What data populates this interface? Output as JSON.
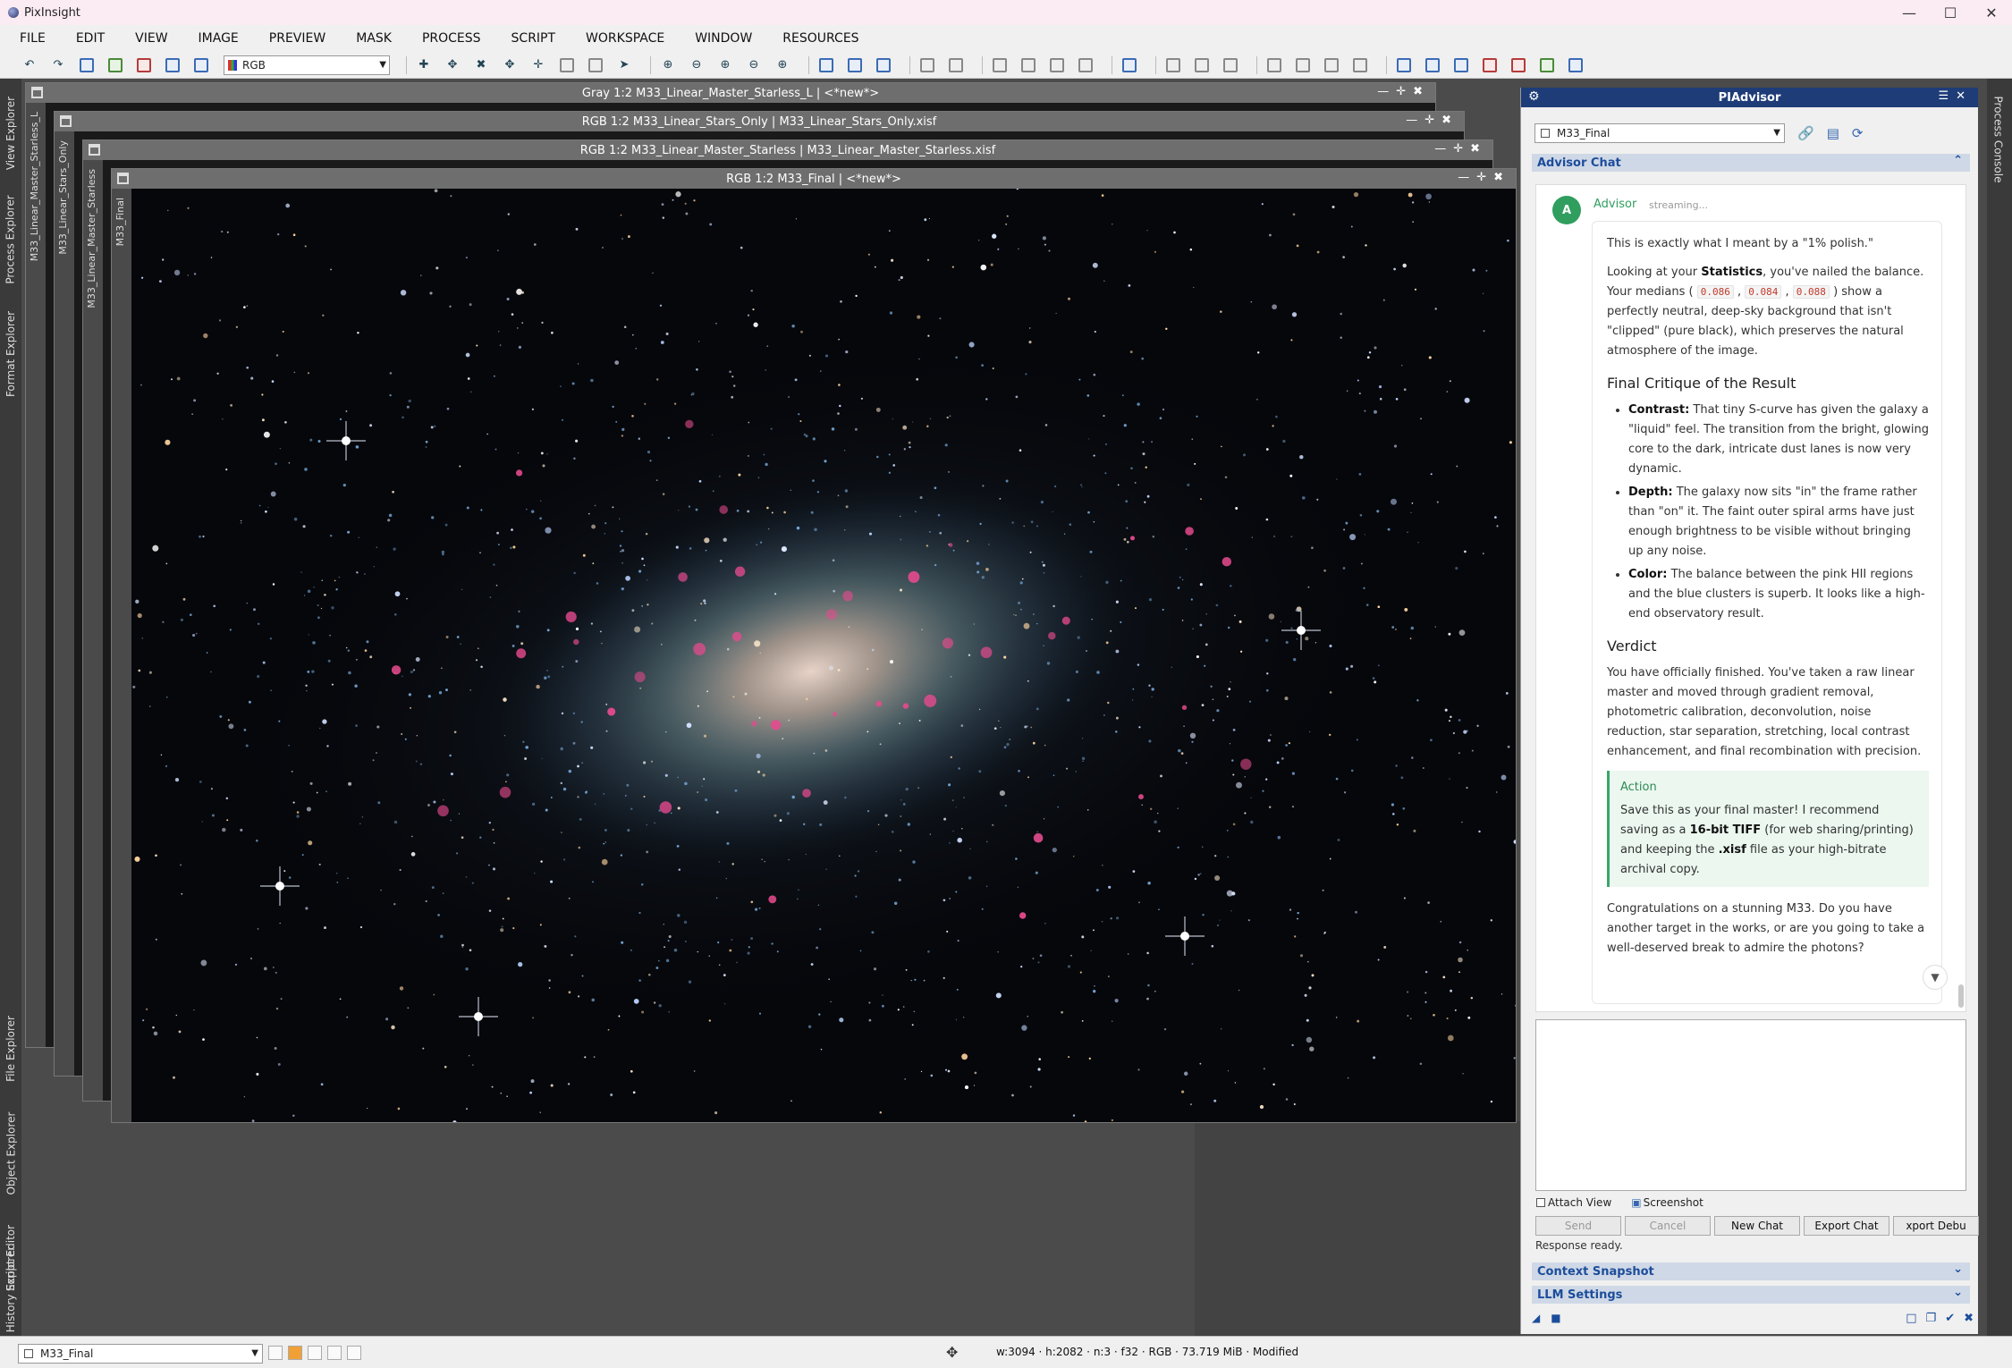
{
  "app": {
    "title": "PixInsight"
  },
  "menu": [
    "FILE",
    "EDIT",
    "VIEW",
    "IMAGE",
    "PREVIEW",
    "MASK",
    "PROCESS",
    "SCRIPT",
    "WORKSPACE",
    "WINDOW",
    "RESOURCES"
  ],
  "toolbar": {
    "channel_select": "RGB"
  },
  "left_tabs": [
    "View Explorer",
    "Process Explorer",
    "Format Explorer",
    "File Explorer",
    "Object Explorer",
    "Script Editor",
    "History Explorer"
  ],
  "right_tabs": [
    "Process Console"
  ],
  "windows": [
    {
      "title": "Gray 1:2 M33_Linear_Master_Starless_L | <*new*>",
      "side": "M33_Linear_Master_Starless_L"
    },
    {
      "title": "RGB 1:2 M33_Linear_Stars_Only | M33_Linear_Stars_Only.xisf",
      "side": "M33_Linear_Stars_Only"
    },
    {
      "title": "RGB 1:2 M33_Linear_Master_Starless | M33_Linear_Master_Starless.xisf",
      "side": "M33_Linear_Master_Starless"
    },
    {
      "title": "RGB 1:2 M33_Final | <*new*>",
      "side": "M33_Final"
    }
  ],
  "panel": {
    "title": "PIAdvisor",
    "view_select": "M33_Final",
    "advisor_chat_header": "Advisor Chat",
    "sender_initial": "A",
    "sender": "Advisor",
    "sender_state": "streaming...",
    "p1": "This is exactly what I meant by a \"1% polish.\"",
    "p2_a": "Looking at your ",
    "p2_b": "Statistics",
    "p2_c": ", you've nailed the balance. Your medians (",
    "median1": "0.086",
    "median2": "0.084",
    "median3": "0.088",
    "p2_d": ") show a perfectly neutral, deep-sky background that isn't \"clipped\" (pure black), which preserves the natural atmosphere of the image.",
    "h_critique": "Final Critique of the Result",
    "b1_label": "Contrast:",
    "b1_text": " That tiny S-curve has given the galaxy a \"liquid\" feel. The transition from the bright, glowing core to the dark, intricate dust lanes is now very dynamic.",
    "b2_label": "Depth:",
    "b2_text": " The galaxy now sits \"in\" the frame rather than \"on\" it. The faint outer spiral arms have just enough brightness to be visible without bringing up any noise.",
    "b3_label": "Color:",
    "b3_text": " The balance between the pink HII regions and the blue clusters is superb. It looks like a high-end observatory result.",
    "h_verdict": "Verdict",
    "verdict": "You have officially finished. You've taken a raw linear master and moved through gradient removal, photometric calibration, deconvolution, noise reduction, star separation, stretching, local contrast enhancement, and final recombination with precision.",
    "action_title": "Action",
    "action_a": "Save this as your final master! I recommend saving as a ",
    "action_b": "16-bit TIFF",
    "action_c": " (for web sharing/printing) and keeping the ",
    "action_d": ".xisf",
    "action_e": " file as your high-bitrate archival copy.",
    "closing": "Congratulations on a stunning M33. Do you have another target in the works, or are you going to take a well-deserved break to admire the photons?",
    "attach_view": "Attach View",
    "screenshot": "Screenshot",
    "buttons": {
      "send": "Send",
      "cancel": "Cancel",
      "new_chat": "New Chat",
      "export_chat": "Export Chat",
      "export_debug": "xport Debu"
    },
    "status": "Response ready.",
    "context_snapshot": "Context Snapshot",
    "llm_settings": "LLM Settings"
  },
  "statusbar": {
    "view": "M33_Final",
    "info": "w:3094 · h:2082 · n:3 · f32 · RGB · 73.719 MiB · Modified"
  }
}
